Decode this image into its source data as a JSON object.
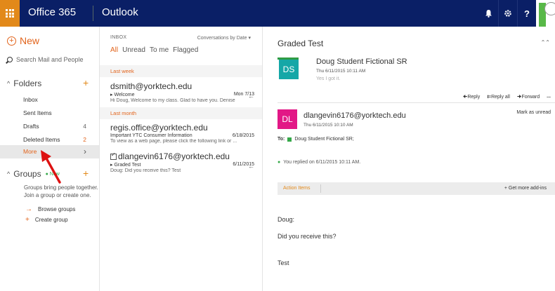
{
  "topbar": {
    "brand": "Office 365",
    "app": "Outlook",
    "bell_icon": "bell-icon",
    "gear_icon": "gear-icon",
    "help_label": "?",
    "colors": {
      "bar": "#0a1f66",
      "waffle": "#e2891a"
    }
  },
  "leftnav": {
    "new_label": "New",
    "search_label": "Search Mail and People",
    "folders_label": "Folders",
    "folders": [
      {
        "name": "Inbox",
        "count": ""
      },
      {
        "name": "Sent Items",
        "count": ""
      },
      {
        "name": "Drafts",
        "count": "4"
      },
      {
        "name": "Deleted Items",
        "count": "2"
      },
      {
        "name": "More",
        "count": ""
      }
    ],
    "groups_label": "Groups",
    "groups_new": "New",
    "groups_note": "Groups bring people together. Join a group or create one.",
    "browse_groups": "Browse groups",
    "create_group": "Create group"
  },
  "msglist": {
    "inbox_title": "INBOX",
    "sort_label": "Conversations by Date",
    "filters": [
      "All",
      "Unread",
      "To me",
      "Flagged"
    ],
    "groups": [
      "Last week",
      "Last month"
    ],
    "messages": [
      {
        "from": "dsmith@yorktech.edu",
        "subject": "Welcome",
        "date": "Mon 7/13",
        "preview": "Hi Doug,  Welcome to my class. Glad to have you.  Denise"
      },
      {
        "from": "regis.office@yorktech.edu",
        "subject": "Important YTC Consumer Information",
        "date": "6/18/2015",
        "preview": "To view as a web page, please click the following link or ..."
      },
      {
        "from": "dlangevin6176@yorktech.edu",
        "subject": "Graded Test",
        "date": "6/11/2015",
        "preview": "Doug:  Did you receive this?  Test"
      }
    ]
  },
  "reading": {
    "subject": "Graded Test",
    "first": {
      "initials": "DS",
      "name": "Doug Student Fictional SR",
      "date": "Thu 6/11/2015 10:11 AM",
      "preview": "Yes I got it."
    },
    "actions": {
      "reply": "Reply",
      "reply_all": "Reply all",
      "forward": "Forward",
      "more": "..."
    },
    "mark_unread": "Mark as unread",
    "second": {
      "initials": "DL",
      "name": "dlangevin6176@yorktech.edu",
      "date": "Thu 6/11/2015 10:10 AM"
    },
    "to_label": "To:",
    "to_value": "Doug Student Fictional SR;",
    "replied": "You replied on 6/11/2015 10:11 AM.",
    "action_items": "Action Items",
    "get_addins": "Get more add-ins",
    "body": [
      "Doug:",
      "Did you receive this?",
      "Test"
    ]
  }
}
